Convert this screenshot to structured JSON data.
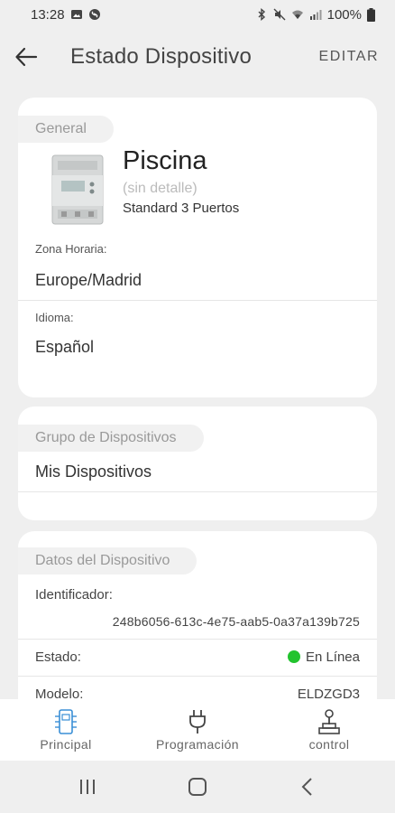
{
  "status": {
    "time": "13:28",
    "battery": "100%"
  },
  "appbar": {
    "title": "Estado Dispositivo",
    "edit_label": "EDITAR"
  },
  "general": {
    "section_label": "General",
    "device_name": "Piscina",
    "device_detail": "(sin detalle)",
    "device_model": "Standard 3 Puertos",
    "timezone_label": "Zona Horaria:",
    "timezone_value": "Europe/Madrid",
    "language_label": "Idioma:",
    "language_value": "Español"
  },
  "group": {
    "section_label": "Grupo de Dispositivos",
    "value": "Mis Dispositivos"
  },
  "device_data": {
    "section_label": "Datos del Dispositivo",
    "id_label": "Identificador:",
    "id_value": "248b6056-613c-4e75-aab5-0a37a139b725",
    "state_label": "Estado:",
    "state_value": "En Línea",
    "state_color": "#22c32e",
    "model_label": "Modelo:",
    "model_value": "ELDZGD3"
  },
  "bottom_nav": {
    "items": [
      {
        "label": "Principal",
        "icon": "device-icon"
      },
      {
        "label": "Programación",
        "icon": "plug-icon"
      },
      {
        "label": "control",
        "icon": "joystick-icon"
      }
    ]
  }
}
